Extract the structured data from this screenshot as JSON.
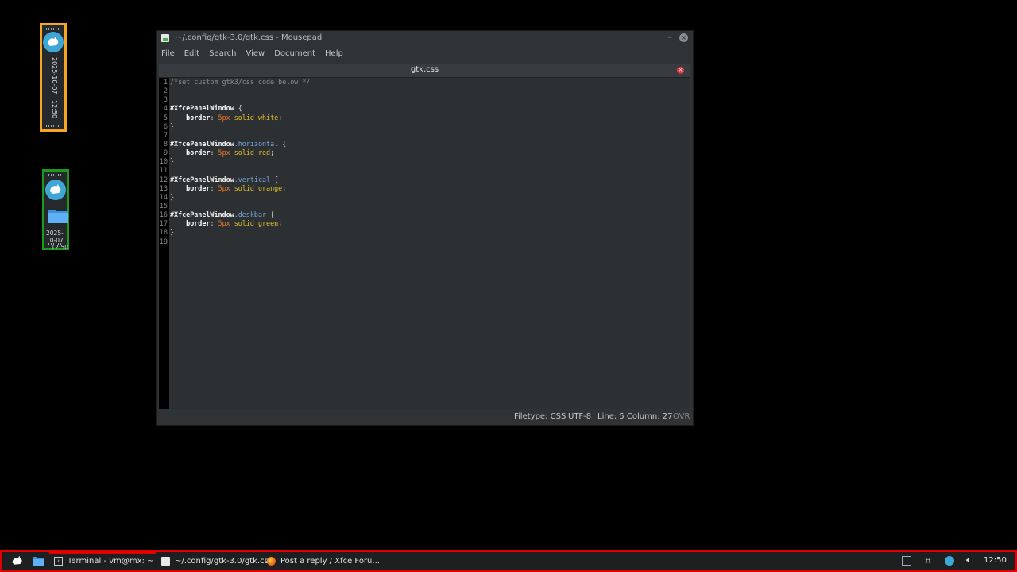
{
  "left_panel": {
    "date": "2025-10-07",
    "time": "12:50"
  },
  "desk_panel": {
    "date": "2025-10-07",
    "time": "12:50"
  },
  "window": {
    "title": "~/.config/gtk-3.0/gtk.css - Mousepad",
    "minimize_glyph": "–",
    "close_glyph": "×",
    "menu": [
      "File",
      "Edit",
      "Search",
      "View",
      "Document",
      "Help"
    ],
    "tab_label": "gtk.css",
    "tab_close_glyph": "×",
    "status": {
      "filetype": "Filetype: CSS",
      "encoding": "UTF-8",
      "position": "Line: 5 Column: 27",
      "mode": "OVR"
    }
  },
  "code_lines": [
    {
      "n": "1",
      "tokens": [
        [
          "c-comment",
          "/*set custom gtk3/css code below */"
        ]
      ]
    },
    {
      "n": "2",
      "tokens": []
    },
    {
      "n": "3",
      "tokens": []
    },
    {
      "n": "4",
      "tokens": [
        [
          "c-id",
          "#XfcePanelWindow"
        ],
        [
          "c-punc",
          " {"
        ]
      ]
    },
    {
      "n": "5",
      "tokens": [
        [
          "c-punc",
          "    "
        ],
        [
          "c-prop",
          "border"
        ],
        [
          "c-punc",
          ": "
        ],
        [
          "c-num",
          "5px"
        ],
        [
          "c-val",
          " solid white"
        ],
        [
          "c-punc",
          ";"
        ]
      ]
    },
    {
      "n": "6",
      "tokens": [
        [
          "c-punc",
          "}"
        ]
      ]
    },
    {
      "n": "7",
      "tokens": []
    },
    {
      "n": "8",
      "tokens": [
        [
          "c-id",
          "#XfcePanelWindow"
        ],
        [
          "c-class",
          ".horizontal"
        ],
        [
          "c-punc",
          " {"
        ]
      ]
    },
    {
      "n": "9",
      "tokens": [
        [
          "c-punc",
          "    "
        ],
        [
          "c-prop",
          "border"
        ],
        [
          "c-punc",
          ": "
        ],
        [
          "c-num",
          "5px"
        ],
        [
          "c-val",
          " solid red"
        ],
        [
          "c-punc",
          ";"
        ]
      ]
    },
    {
      "n": "10",
      "tokens": [
        [
          "c-punc",
          "}"
        ]
      ]
    },
    {
      "n": "11",
      "tokens": []
    },
    {
      "n": "12",
      "tokens": [
        [
          "c-id",
          "#XfcePanelWindow"
        ],
        [
          "c-class",
          ".vertical"
        ],
        [
          "c-punc",
          " {"
        ]
      ]
    },
    {
      "n": "13",
      "tokens": [
        [
          "c-punc",
          "    "
        ],
        [
          "c-prop",
          "border"
        ],
        [
          "c-punc",
          ": "
        ],
        [
          "c-num",
          "5px"
        ],
        [
          "c-val",
          " solid orange"
        ],
        [
          "c-punc",
          ";"
        ]
      ]
    },
    {
      "n": "14",
      "tokens": [
        [
          "c-punc",
          "}"
        ]
      ]
    },
    {
      "n": "15",
      "tokens": []
    },
    {
      "n": "16",
      "tokens": [
        [
          "c-id",
          "#XfcePanelWindow"
        ],
        [
          "c-class",
          ".deskbar"
        ],
        [
          "c-punc",
          " {"
        ]
      ]
    },
    {
      "n": "17",
      "tokens": [
        [
          "c-punc",
          "    "
        ],
        [
          "c-prop",
          "border"
        ],
        [
          "c-punc",
          ": "
        ],
        [
          "c-num",
          "5px"
        ],
        [
          "c-val",
          " solid green"
        ],
        [
          "c-punc",
          ";"
        ]
      ]
    },
    {
      "n": "18",
      "tokens": [
        [
          "c-punc",
          "}"
        ]
      ]
    },
    {
      "n": "19",
      "tokens": []
    }
  ],
  "taskbar": {
    "tasks": [
      {
        "label": "Terminal - vm@mx: ~",
        "icon": "terminal-icon"
      },
      {
        "label": "~/.config/gtk-3.0/gtk.cs...",
        "icon": "mousepad-icon"
      },
      {
        "label": "Post a reply / Xfce Foru...",
        "icon": "firefox-icon"
      }
    ],
    "clock": "12:50"
  },
  "colors": {
    "horizontal_border": "#e00000",
    "vertical_border": "#f5a623",
    "deskbar_border": "#1c9a1c",
    "xfce_logo": "#3fa7d6"
  }
}
